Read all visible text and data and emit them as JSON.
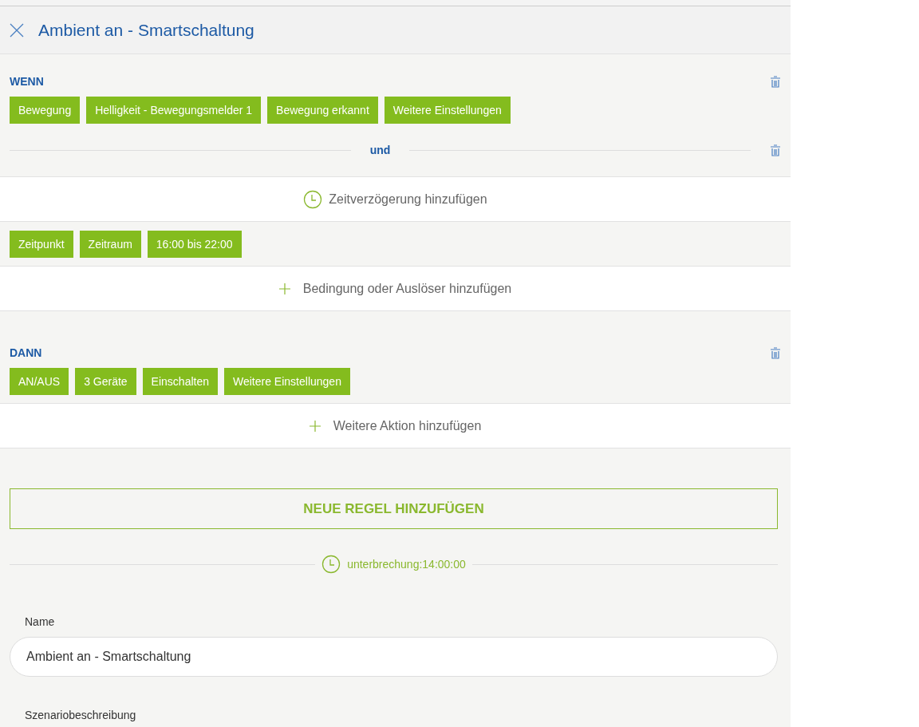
{
  "header": {
    "title": "Ambient an - Smartschaltung"
  },
  "when": {
    "heading": "WENN",
    "chips": [
      "Bewegung",
      "Helligkeit - Bewegungsmelder 1",
      "Bewegung erkannt",
      "Weitere Einstellungen"
    ],
    "connector": "und"
  },
  "delay": {
    "label": "Zeitverzögerung hinzufügen"
  },
  "time_chips": [
    "Zeitpunkt",
    "Zeitraum",
    "16:00 bis 22:00"
  ],
  "add_condition": {
    "label": "Bedingung oder Auslöser hinzufügen"
  },
  "then": {
    "heading": "DANN",
    "chips": [
      "AN/AUS",
      "3 Geräte",
      "Einschalten",
      "Weitere Einstellungen"
    ]
  },
  "add_action": {
    "label": "Weitere Aktion hinzufügen"
  },
  "new_rule_button": "NEUE REGEL HINZUFÜGEN",
  "interruption": "unterbrechung:14:00:00",
  "name_field": {
    "label": "Name",
    "value": "Ambient an - Smartschaltung"
  },
  "description_label": "Szenariobeschreibung"
}
